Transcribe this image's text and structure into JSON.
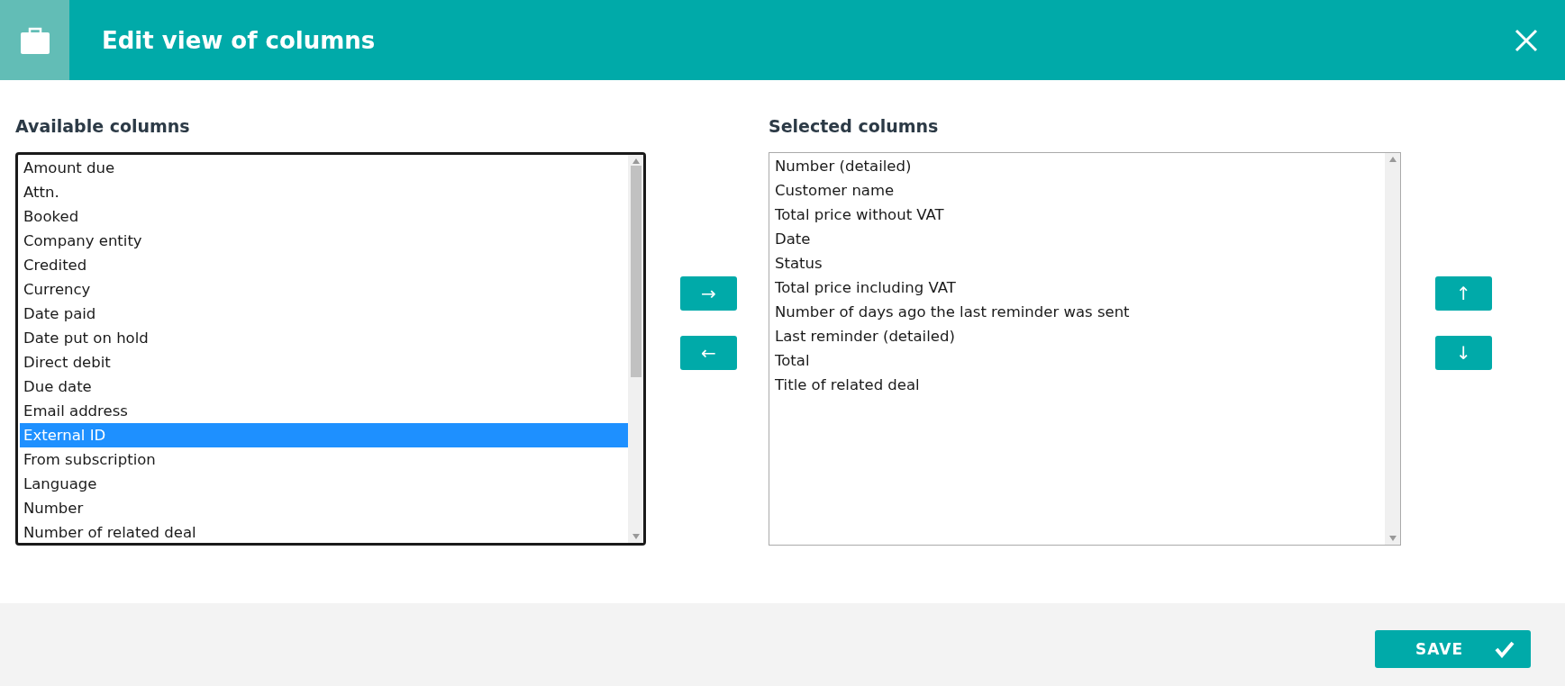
{
  "window": {
    "title": "Edit view of columns"
  },
  "available": {
    "label": "Available columns",
    "items": [
      {
        "text": "Amount due",
        "selected": false
      },
      {
        "text": "Attn.",
        "selected": false
      },
      {
        "text": "Booked",
        "selected": false
      },
      {
        "text": "Company entity",
        "selected": false
      },
      {
        "text": "Credited",
        "selected": false
      },
      {
        "text": "Currency",
        "selected": false
      },
      {
        "text": "Date paid",
        "selected": false
      },
      {
        "text": "Date put on hold",
        "selected": false
      },
      {
        "text": "Direct debit",
        "selected": false
      },
      {
        "text": "Due date",
        "selected": false
      },
      {
        "text": "Email address",
        "selected": false
      },
      {
        "text": "External ID",
        "selected": true
      },
      {
        "text": "From subscription",
        "selected": false
      },
      {
        "text": "Language",
        "selected": false
      },
      {
        "text": "Number",
        "selected": false
      },
      {
        "text": "Number of related deal",
        "selected": false
      }
    ]
  },
  "move_buttons": [
    "→",
    "←"
  ],
  "selected_list": {
    "label": "Selected columns",
    "items": [
      {
        "text": "Number (detailed)",
        "selected": false
      },
      {
        "text": "Customer name",
        "selected": false
      },
      {
        "text": "Total price without VAT",
        "selected": false
      },
      {
        "text": "Date",
        "selected": false
      },
      {
        "text": "Status",
        "selected": false
      },
      {
        "text": "Total price including VAT",
        "selected": false
      },
      {
        "text": "Number of days ago the last reminder was sent",
        "selected": false
      },
      {
        "text": "Last reminder (detailed)",
        "selected": false
      },
      {
        "text": "Total",
        "selected": false
      },
      {
        "text": "Title of related deal",
        "selected": false
      }
    ]
  },
  "order_buttons": [
    "↑",
    "↓"
  ],
  "footer": {
    "save": "SAVE"
  }
}
